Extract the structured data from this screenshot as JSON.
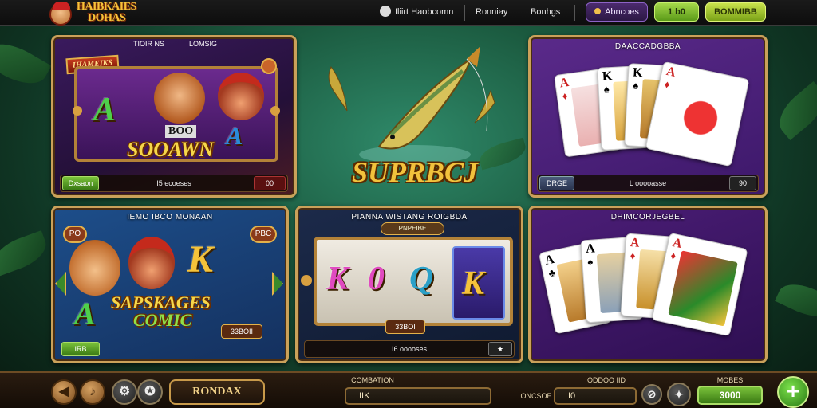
{
  "topbar": {
    "logo_line1": "HAIBKAIES",
    "logo_line2": "DOHAS",
    "nav_user": "Iliirt Haobcomn",
    "nav_item2": "Ronniay",
    "nav_item3": "Bonhgs",
    "account_label": "Abncoes",
    "balance_label": "1 b0",
    "promo_label": "BOMMIBB"
  },
  "panels": {
    "p1": {
      "title_left": "TIOIR NS",
      "title_right": "LOMSIG",
      "banner": "IHAMEIKS",
      "word": "SOOAWN",
      "sub": "BOO",
      "play_label": "Dxsaon",
      "footer_text": "I5 ecoeses",
      "bet_label": "00"
    },
    "center": {
      "title": "SUPRBCJ"
    },
    "p2": {
      "title": "DAACCADGBBA",
      "play_label": "DRGE",
      "footer_text": "L ooooasse",
      "bet_label": "90"
    },
    "p3": {
      "title": "IEMO IBCO MONAAN",
      "badge_left": "PO",
      "badge_right": "PBC",
      "word1": "SAPSKAGES",
      "word2": "COMIC",
      "score": "33BOII",
      "play_label": "IRB"
    },
    "p4": {
      "title": "PIANNA WISTANG ROIGBDA",
      "banner": "PNPEIBE",
      "score": "33BOI",
      "footer_text": "I6 ooooses",
      "star": "★"
    },
    "p5": {
      "title": "DHIMCORJEGBEL"
    }
  },
  "bottombar": {
    "round_label": "RONDAX",
    "conv_label": "COMBATION",
    "conv_value": "IIK",
    "odd_label": "ODDOO IID",
    "bet_caption": "ONCSOE",
    "bet_value": "I0",
    "mobes_label": "MOBES",
    "credit_value": "3000",
    "add_icon": "+"
  }
}
